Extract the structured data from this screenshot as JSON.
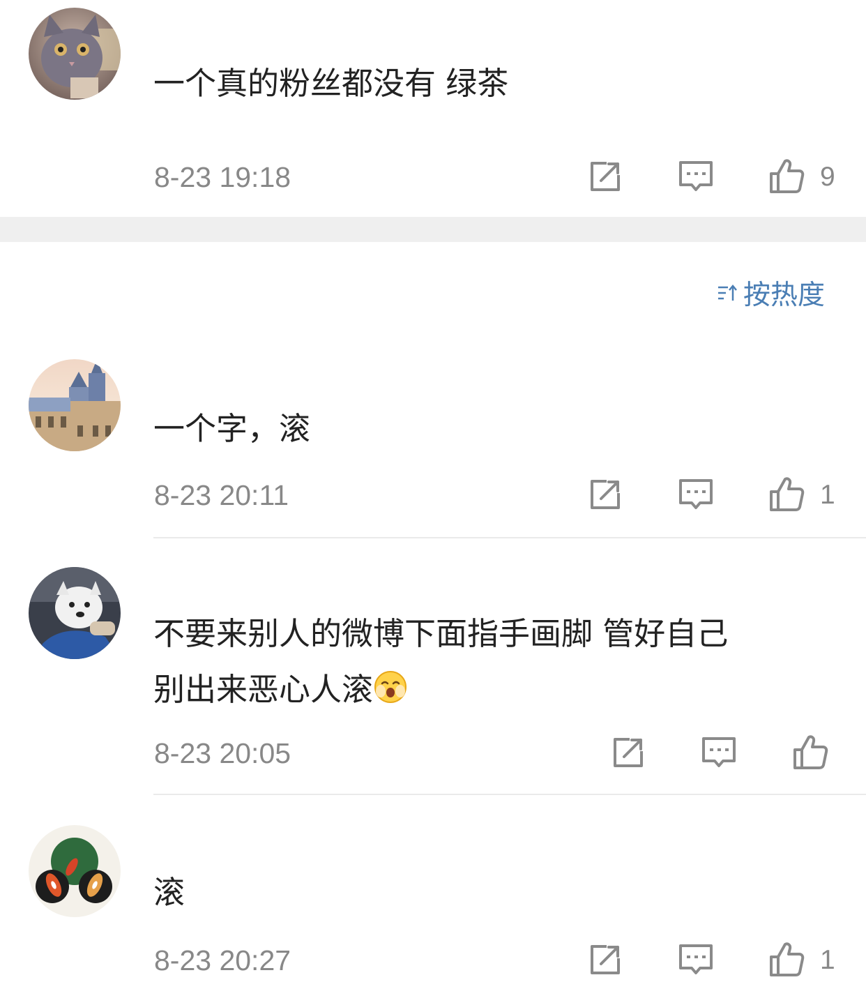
{
  "comments_top": [
    {
      "text": "一个真的粉丝都没有 绿茶",
      "time": "8-23 19:18",
      "likes": "9"
    }
  ],
  "sort_label": "按热度",
  "comments": [
    {
      "text": "一个字，滚",
      "time": "8-23 20:11",
      "likes": "1"
    },
    {
      "text_line1": "不要来别人的微博下面指手画脚 管好自己",
      "text_line2": "别出来恶心人滚",
      "emoji": "blush-emoji",
      "time": "8-23 20:05",
      "likes": ""
    },
    {
      "text": "滚",
      "time": "8-23 20:27",
      "likes": "1"
    }
  ],
  "icons": {
    "repost": "repost-icon",
    "comment": "comment-icon",
    "like": "thumbs-up-icon",
    "sort": "sort-icon"
  },
  "colors": {
    "time": "#888888",
    "sort": "#4a7eb4",
    "icon": "#8a8a8a",
    "band": "#efefef"
  }
}
